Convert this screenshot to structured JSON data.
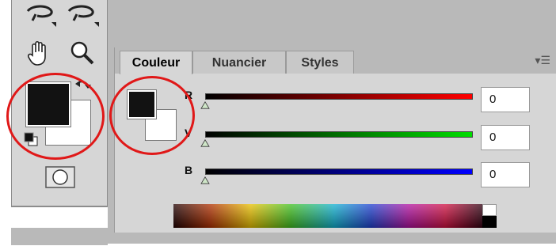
{
  "panel": {
    "tabs": [
      {
        "label": "Couleur",
        "active": true
      },
      {
        "label": "Nuancier",
        "active": false
      },
      {
        "label": "Styles",
        "active": false
      }
    ],
    "menu_icon": "panel-menu-icon"
  },
  "sliders": [
    {
      "label": "R",
      "value": "0",
      "color": "#ff0000",
      "level": 0
    },
    {
      "label": "V",
      "value": "0",
      "color": "#00dd00",
      "level": 0
    },
    {
      "label": "B",
      "value": "0",
      "color": "#0000ff",
      "level": 0
    }
  ],
  "colors": {
    "foreground": "#121212",
    "background": "#ffffff",
    "annotation": "#e01818"
  },
  "toolbox": {
    "icons": [
      "lasso-icon",
      "polygon-lasso-icon",
      "hand-icon",
      "zoom-icon",
      "swap-colors-icon",
      "default-colors-icon",
      "quick-mask-icon"
    ]
  }
}
